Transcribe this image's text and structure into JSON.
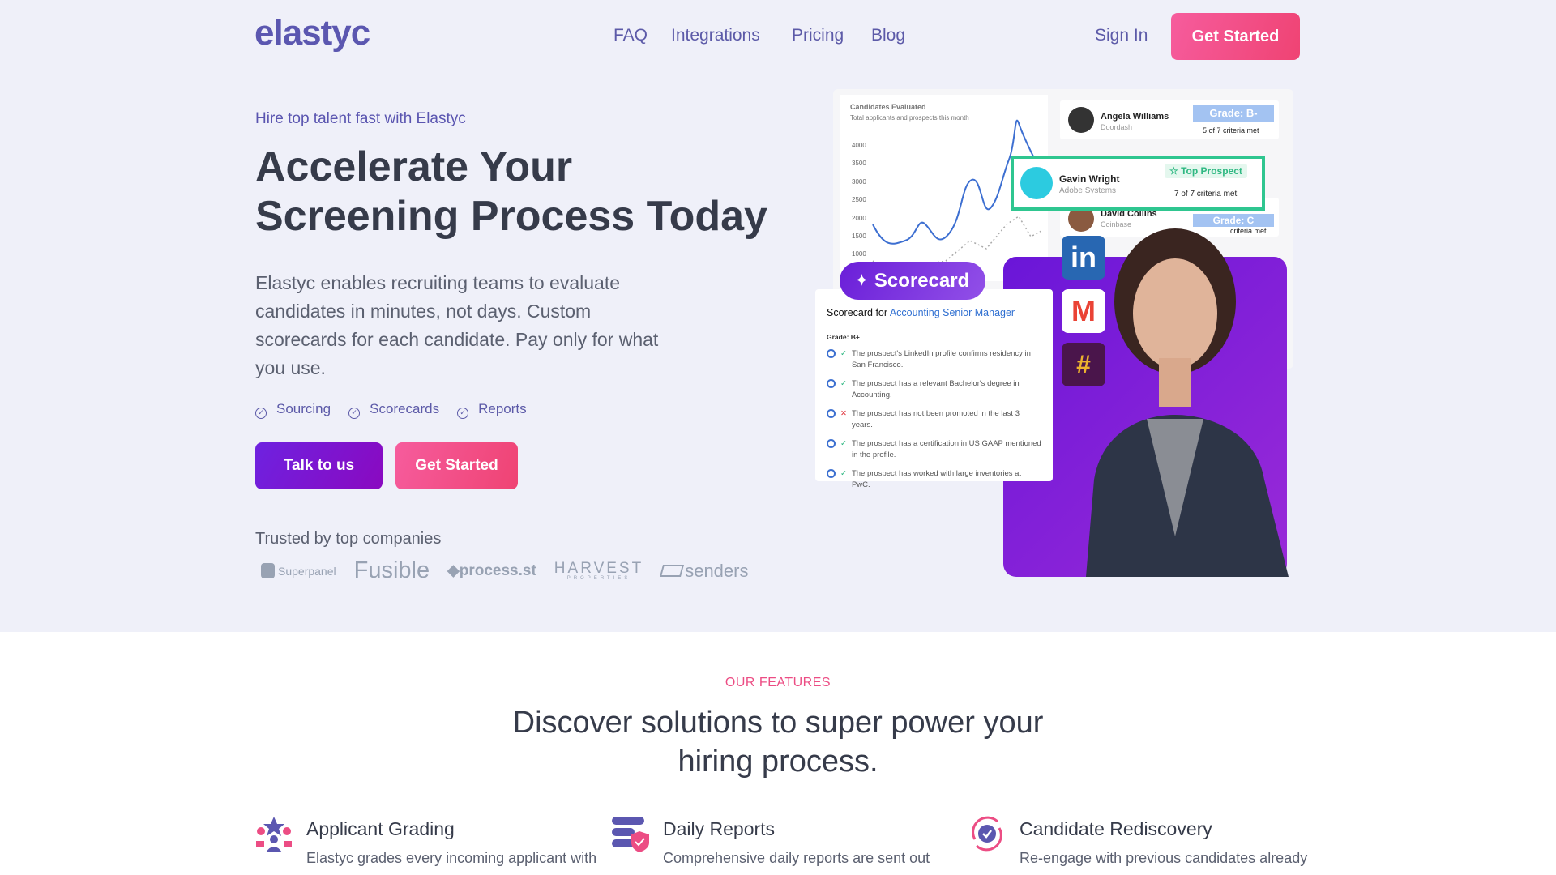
{
  "header": {
    "logo": "elastyc",
    "nav": [
      "FAQ",
      "Integrations",
      "Pricing",
      "Blog"
    ],
    "sign_in": "Sign In",
    "get_started": "Get Started"
  },
  "hero": {
    "eyebrow": "Hire top talent fast with Elastyc",
    "title_line1": "Accelerate Your",
    "title_line2": "Screening Process Today",
    "lead": "Elastyc enables recruiting teams to evaluate candidates in minutes, not days. Custom scorecards for each candidate. Pay only for what you use.",
    "checks": [
      "Sourcing",
      "Scorecards",
      "Reports"
    ],
    "talk_button": "Talk to us",
    "get_started_button": "Get Started",
    "trusted": "Trusted by top companies",
    "logos": [
      "Superpanel",
      "Fusible",
      "process.st",
      "HARVEST",
      "PROPERTIES",
      "senders"
    ]
  },
  "illustration": {
    "chart_title": "Candidates Evaluated",
    "chart_subtitle": "Total applicants and prospects this month",
    "y_ticks": [
      "4000",
      "3500",
      "3000",
      "2500",
      "2000",
      "1500",
      "1000"
    ],
    "candidates": [
      {
        "name": "Angela Williams",
        "company": "Doordash",
        "grade": "Grade: B-",
        "criteria": "5 of 7 criteria met"
      },
      {
        "name": "Gavin Wright",
        "company": "Adobe Systems",
        "badge": "Top Prospect",
        "criteria": "7 of 7 criteria met"
      },
      {
        "name": "David Collins",
        "company": "Coinbase",
        "grade": "Grade: C",
        "criteria": "criteria met"
      }
    ],
    "scorecard_badge": "Scorecard",
    "scorecard_for": "Scorecard for",
    "role": "Accounting Senior Manager",
    "grade": "Grade: B+",
    "criteria": [
      {
        "ok": true,
        "text": "The prospect's LinkedIn profile confirms residency in San Francisco."
      },
      {
        "ok": true,
        "text": "The prospect has a relevant Bachelor's degree in Accounting."
      },
      {
        "ok": false,
        "text": "The prospect has not been promoted in the last 3 years."
      },
      {
        "ok": true,
        "text": "The prospect has a certification in US GAAP mentioned in the profile."
      },
      {
        "ok": true,
        "text": "The prospect has worked with large inventories at PwC."
      }
    ]
  },
  "features": {
    "eyebrow": "OUR FEATURES",
    "title_line1": "Discover solutions to super power your",
    "title_line2": "hiring process.",
    "items": [
      {
        "title": "Applicant Grading",
        "desc": "Elastyc grades every incoming applicant with"
      },
      {
        "title": "Daily Reports",
        "desc": "Comprehensive daily reports are sent out"
      },
      {
        "title": "Candidate Rediscovery",
        "desc": "Re-engage with previous candidates already"
      }
    ]
  },
  "colors": {
    "brand": "#5b57b0",
    "pink": "#ef4373",
    "purple": "#7a16d6",
    "bg": "#eff0f9"
  }
}
